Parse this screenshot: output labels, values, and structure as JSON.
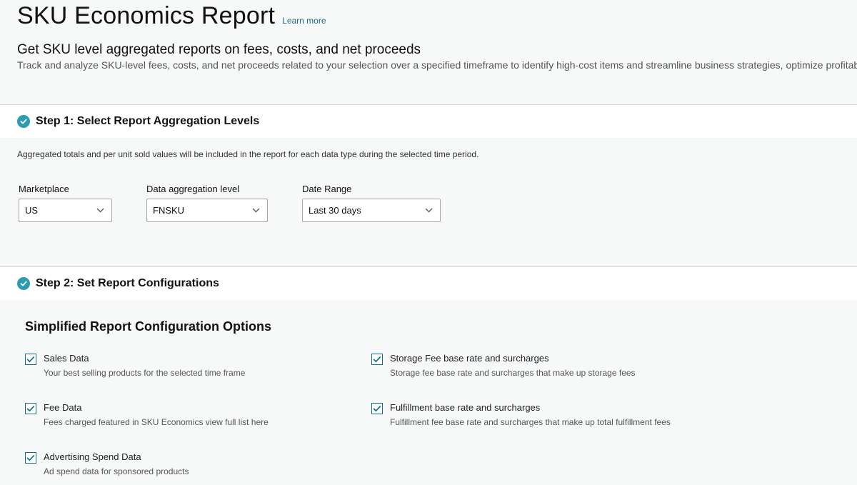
{
  "header": {
    "title": "SKU Economics Report",
    "learn_more": "Learn more",
    "subtitle": "Get SKU level aggregated reports on fees, costs, and net proceeds",
    "description": "Track and analyze SKU-level fees, costs, and net proceeds related to your selection over a specified timeframe to identify high-cost items and streamline business strategies, optimize profitability."
  },
  "step1": {
    "title": "Step 1: Select Report Aggregation Levels",
    "info": "Aggregated totals and per unit sold values will be included in the report for each data type during the selected time period.",
    "fields": [
      {
        "label": "Marketplace",
        "value": "US"
      },
      {
        "label": "Data aggregation level",
        "value": "FNSKU"
      },
      {
        "label": "Date Range",
        "value": "Last 30 days"
      }
    ]
  },
  "step2": {
    "title": "Step 2: Set Report Configurations",
    "section_heading": "Simplified Report Configuration Options",
    "options": [
      {
        "label": "Sales Data",
        "desc": "Your best selling products for the selected time frame",
        "checked": true
      },
      {
        "label": "Fee Data",
        "desc": "Fees charged featured in SKU Economics view full list here",
        "checked": true
      },
      {
        "label": "Advertising Spend Data",
        "desc": "Ad spend data for sponsored products",
        "checked": true
      },
      {
        "label": "Storage Fee base rate and surcharges",
        "desc": "Storage fee base rate and surcharges that make up storage fees",
        "checked": true
      },
      {
        "label": "Fulfillment base rate and surcharges",
        "desc": "Fulfillment fee base rate and surcharges that make up total fulfillment fees",
        "checked": true
      }
    ]
  },
  "colors": {
    "accent": "#2d9cb2",
    "checkbox_border": "#0f6f86",
    "link": "#1a6b8a"
  },
  "icons": {
    "step_complete": "check-circle-icon",
    "dropdown": "chevron-down-icon",
    "checked": "checkmark-icon"
  }
}
